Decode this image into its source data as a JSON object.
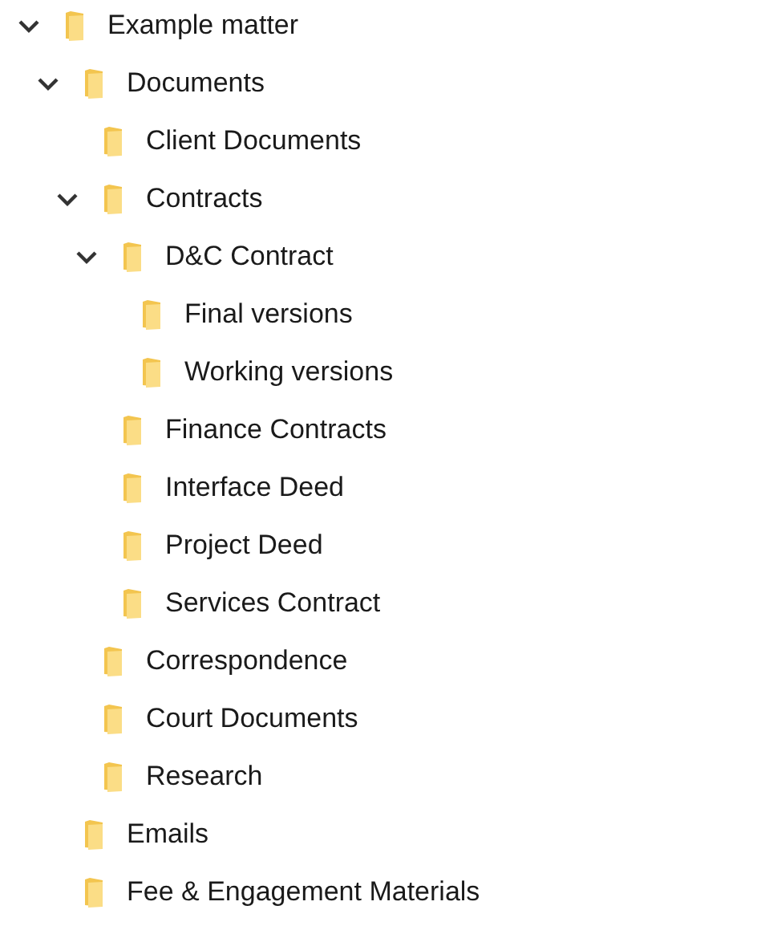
{
  "tree": [
    {
      "label": "Example matter",
      "expanded": true,
      "children": [
        {
          "label": "Documents",
          "expanded": true,
          "children": [
            {
              "label": "Client Documents"
            },
            {
              "label": "Contracts",
              "expanded": true,
              "children": [
                {
                  "label": "D&C Contract",
                  "expanded": true,
                  "children": [
                    {
                      "label": "Final versions"
                    },
                    {
                      "label": "Working versions"
                    }
                  ]
                },
                {
                  "label": "Finance Contracts"
                },
                {
                  "label": "Interface Deed"
                },
                {
                  "label": "Project Deed"
                },
                {
                  "label": "Services Contract"
                }
              ]
            },
            {
              "label": "Correspondence"
            },
            {
              "label": "Court Documents"
            },
            {
              "label": "Research"
            }
          ]
        },
        {
          "label": "Emails"
        },
        {
          "label": "Fee & Engagement Materials"
        }
      ]
    }
  ]
}
